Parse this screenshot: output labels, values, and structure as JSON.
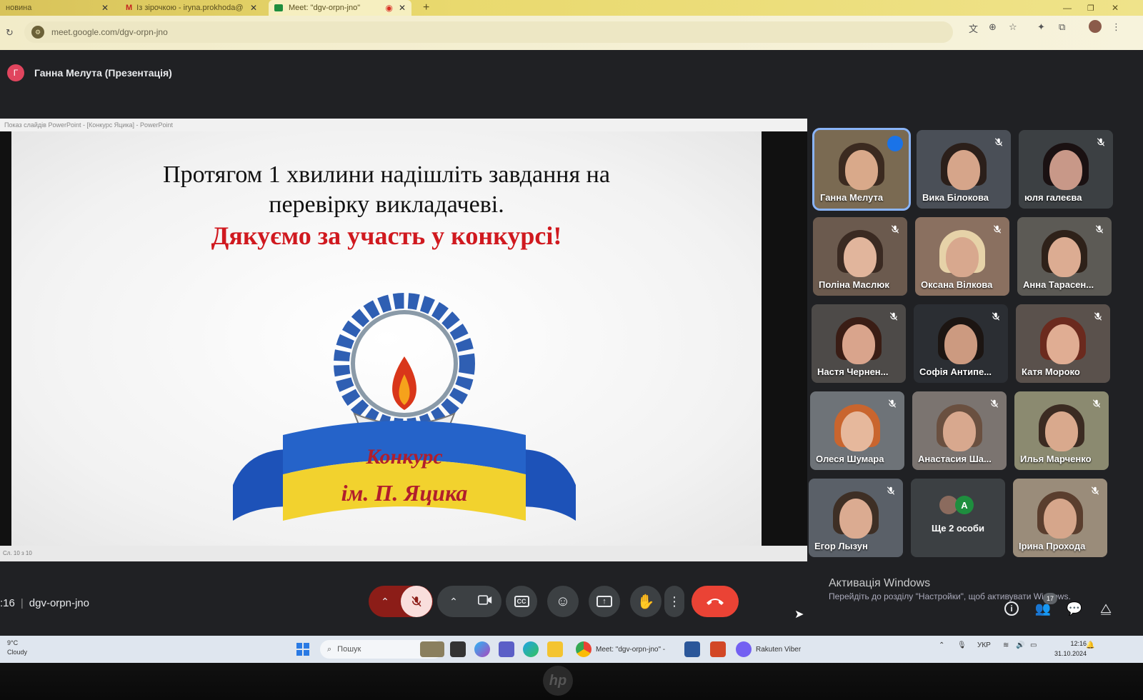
{
  "browser": {
    "tabs": [
      {
        "label": "новина",
        "active": false
      },
      {
        "label": "Із зірочкою - iryna.prokhoda@",
        "active": false
      },
      {
        "label": "Meet: \"dgv-orpn-jno\"",
        "active": true
      }
    ],
    "new_tab_label": "+",
    "url": "meet.google.com/dgv-orpn-jno"
  },
  "meet": {
    "presenter_initial": "Г",
    "presenter_label": "Ганна Мелута (Презентація)",
    "presentation_window_title": "Показ слайдів PowerPoint - [Конкурс Яцика] - PowerPoint",
    "presentation_status": "Сл. 10 з 10",
    "slide": {
      "line1": "Протягом 1 хвилини надішліть завдання на",
      "line2": "перевірку викладачеві.",
      "line3": "Дякуємо за участь у конкурсі!",
      "logo_text1": "Конкурс",
      "logo_text2": "ім. П. Яцика"
    },
    "participants": [
      {
        "name": "Ганна Мелута",
        "speaking": true
      },
      {
        "name": "Вика Білокова",
        "speaking": false
      },
      {
        "name": "юля галеєва",
        "speaking": false
      },
      {
        "name": "Поліна Маслюк",
        "speaking": false
      },
      {
        "name": "Оксана Вілкова",
        "speaking": false
      },
      {
        "name": "Анна Тарасен...",
        "speaking": false
      },
      {
        "name": "Настя Чернен...",
        "speaking": false
      },
      {
        "name": "Софія Антипе...",
        "speaking": false
      },
      {
        "name": "Катя Мороко",
        "speaking": false
      },
      {
        "name": "Олеся Шумара",
        "speaking": false
      },
      {
        "name": "Анастасия Ша...",
        "speaking": false
      },
      {
        "name": "Илья Марченко",
        "speaking": false
      },
      {
        "name": "Егор Лызун",
        "speaking": false
      },
      {
        "name": "Ірина Прохода",
        "speaking": false
      }
    ],
    "more": {
      "avatar_letter": "A",
      "label": "Ще 2 особи"
    },
    "time": ":16",
    "meeting_code": "dgv-orpn-jno",
    "people_count": "17",
    "activation_title": "Активація Windows",
    "activation_text": "Перейдіть до розділу \"Настройки\", щоб активувати Windows."
  },
  "taskbar": {
    "weather_temp": "9°C",
    "weather_text": "Cloudy",
    "search_placeholder": "Пошук",
    "meet_app_label": "Meet: \"dgv-orpn-jno\" -",
    "viber_label": "Rakuten Viber",
    "language": "УКР",
    "time": "12:16",
    "date": "31.10.2024"
  },
  "brand": "hp",
  "colors": {
    "accent_blue": "#8ab4f8",
    "end_call_red": "#ea4335",
    "muted_red": "#8c1d18",
    "slide_red": "#d0191f"
  }
}
